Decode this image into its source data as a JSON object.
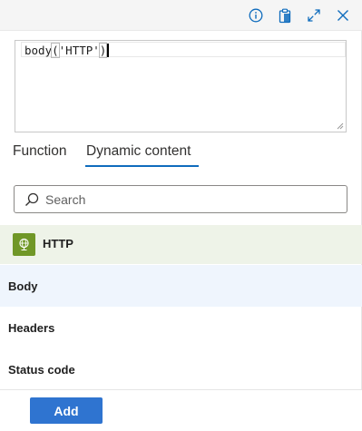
{
  "editor": {
    "expression_prefix": "body",
    "open_paren": "(",
    "argument": "'HTTP'",
    "close_paren": ")"
  },
  "tabs": [
    {
      "label": "Function",
      "active": false
    },
    {
      "label": "Dynamic content",
      "active": true
    }
  ],
  "search": {
    "placeholder": "Search",
    "value": ""
  },
  "group": {
    "title": "HTTP",
    "icon": "globe-icon",
    "color": "#709727"
  },
  "items": [
    {
      "label": "Body",
      "selected": true
    },
    {
      "label": "Headers",
      "selected": false
    },
    {
      "label": "Status code",
      "selected": false
    }
  ],
  "footer": {
    "add_label": "Add"
  },
  "colors": {
    "accent": "#0f6cbd",
    "button": "#2f74d0",
    "selected_row": "#eff5fd",
    "group_bg": "#eef3e8"
  }
}
